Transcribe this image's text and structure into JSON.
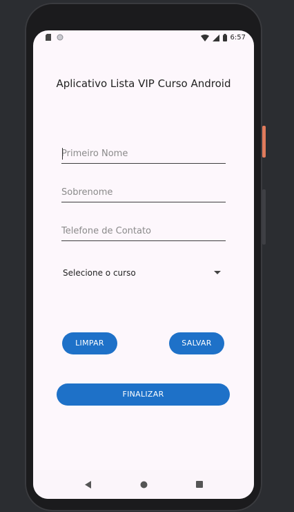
{
  "status_bar": {
    "time": "6:57",
    "left_icons": [
      "sd-card-icon",
      "circle-notification-icon"
    ],
    "right_icons": [
      "wifi-icon",
      "signal-icon",
      "battery-icon"
    ]
  },
  "app": {
    "title": "Aplicativo Lista VIP Curso Android",
    "fields": {
      "first_name_placeholder": "Primeiro Nome",
      "last_name_placeholder": "Sobrenome",
      "phone_placeholder": "Telefone de Contato"
    },
    "course_spinner": {
      "selected": "Selecione o curso"
    },
    "buttons": {
      "clear": "LIMPAR",
      "save": "SALVAR",
      "finish": "FINALIZAR"
    },
    "accent_color": "#1e71c8",
    "background_color": "#fdf7fc"
  },
  "nav_bar": {
    "icons": [
      "back-icon",
      "home-icon",
      "recents-icon"
    ]
  }
}
